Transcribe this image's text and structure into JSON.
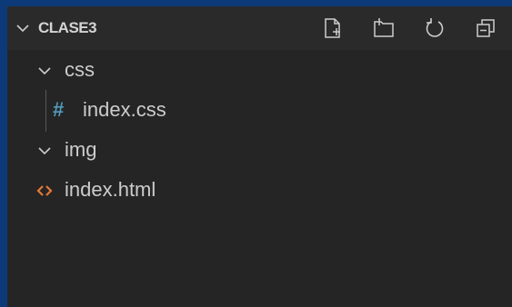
{
  "explorer": {
    "folder_title": "CLASE3",
    "actions": [
      {
        "icon": "new-file-icon"
      },
      {
        "icon": "new-folder-icon"
      },
      {
        "icon": "refresh-icon"
      },
      {
        "icon": "collapse-all-icon"
      }
    ]
  },
  "tree": {
    "items": [
      {
        "label": "css",
        "type": "folder",
        "expanded": true
      },
      {
        "label": "index.css",
        "type": "file",
        "icon": "css-hash-icon",
        "icon_glyph": "#",
        "icon_color": "#519aba"
      },
      {
        "label": "img",
        "type": "folder",
        "expanded": true
      },
      {
        "label": "index.html",
        "type": "file",
        "icon": "html-brackets-icon",
        "icon_color": "#e37933"
      }
    ]
  },
  "colors": {
    "frame_border": "#0c3a78",
    "panel_bg": "#252526",
    "text": "#cccccc",
    "css_icon": "#519aba",
    "html_icon": "#e37933"
  }
}
